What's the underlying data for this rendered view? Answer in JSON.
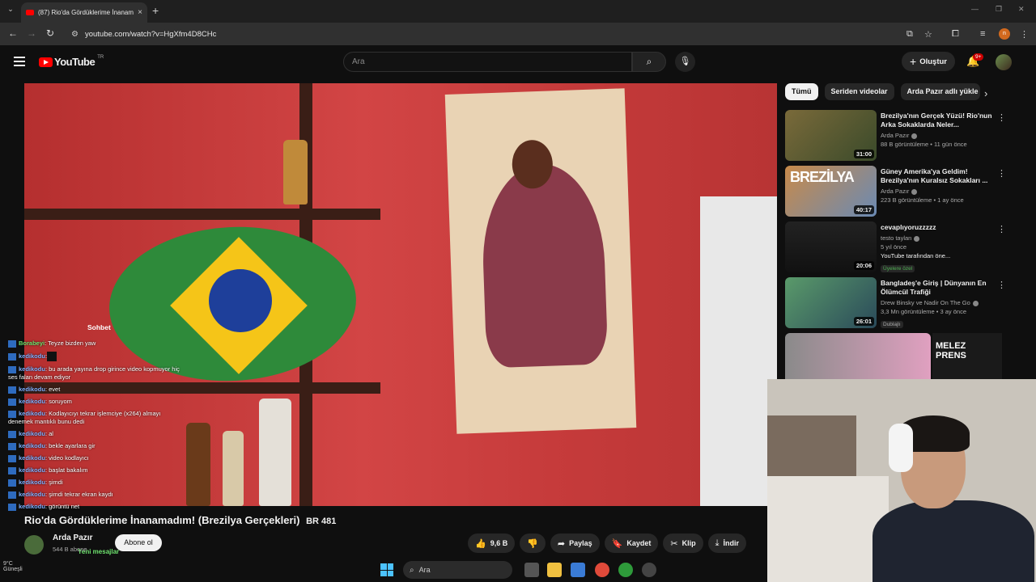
{
  "browser": {
    "tab_title": "(87) Rio'da Gördüklerime İnanam",
    "tab_close": "×",
    "new_tab": "+",
    "url": "youtube.com/watch?v=HgXfm4D8CHc",
    "profile_initial": "n"
  },
  "header": {
    "logo_text": "YouTube",
    "logo_region": "TR",
    "search_placeholder": "Ara",
    "create_label": "Oluştur",
    "notif_badge": "9+"
  },
  "player": {
    "chat_title": "Sohbet"
  },
  "chat": {
    "messages": [
      {
        "user": "Borabeyi",
        "text": ": Teyze bizden yaw",
        "green": true
      },
      {
        "user": "kedikodu",
        "text": ":",
        "block": true
      },
      {
        "user": "kedikodu",
        "text": ": bu arada yayına drop girince video kopmuyor hiç ses falan devam ediyor"
      },
      {
        "user": "kedikodu",
        "text": ": evet"
      },
      {
        "user": "kedikodu",
        "text": ": soruyom"
      },
      {
        "user": "kedikodu",
        "text": ": Kodlayıcıyı tekrar işlemciye (x264) almayı denemek mantıklı bunu dedi"
      },
      {
        "user": "kedikodu",
        "text": ": al"
      },
      {
        "user": "kedikodu",
        "text": ": bekle ayarlara gir"
      },
      {
        "user": "kedikodu",
        "text": ": video kodlayıcı"
      },
      {
        "user": "kedikodu",
        "text": ": başlat bakalım"
      },
      {
        "user": "kedikodu",
        "text": ": şimdi"
      },
      {
        "user": "kedikodu",
        "text": ": şimdi tekrar ekran kaydı"
      },
      {
        "user": "kedikodu",
        "text": ": görüntü net"
      }
    ],
    "new_messages": "Yeni mesajlar"
  },
  "video": {
    "title": "Rio'da Gördüklerime İnanamadım! (Brezilya Gerçekleri)",
    "rank": "BR 481",
    "channel": "Arda Pazır",
    "subscribers": "544 B abone",
    "subscribe_label": "Abone ol",
    "likes": "9,6 B",
    "share_label": "Paylaş",
    "save_label": "Kaydet",
    "clip_label": "Klip",
    "download_label": "İndir"
  },
  "sidebar": {
    "chips": [
      "Tümü",
      "Seriden videolar",
      "Arda Pazır adlı yükle"
    ],
    "recommendations": [
      {
        "title": "Brezilya'nın Gerçek Yüzü! Rio'nun Arka Sokaklarda Neler...",
        "channel": "Arda Pazır",
        "meta": "88 B görüntüleme • 11 gün önce",
        "duration": "31:00",
        "badge": "",
        "color": "#5a4a2c"
      },
      {
        "title": "Güney Amerika'ya Geldim! Brezilya'nın Kuralsız Sokakları ...",
        "channel": "Arda Pazır",
        "meta": "223 B görüntüleme • 1 ay önce",
        "duration": "40:17",
        "badge": "",
        "color": "#b46a3a",
        "thumb_text": "BREZİLYA"
      },
      {
        "title": "cevaplıyoruzzzzz",
        "channel": "testo taylan",
        "meta": "5 yıl önce",
        "meta2": "YouTube tarafından öne...",
        "duration": "20:06",
        "badge": "Üyelere özel",
        "color": "#1a1a1a"
      },
      {
        "title": "Bangladeş'e Giriş | Dünyanın En Ölümcül Trafiği",
        "channel": "Drew Binsky ve Nadir On The Go",
        "meta": "3,3 Mn görüntüleme • 3 ay önce",
        "duration": "26:01",
        "badge": "Dublajlı",
        "color": "#4a7a5a"
      }
    ],
    "partial_thumb_text": "MELEZ PRENS"
  },
  "taskbar": {
    "search_label": "Ara"
  },
  "weather": {
    "temp": "9°C",
    "label": "Güneşli"
  }
}
